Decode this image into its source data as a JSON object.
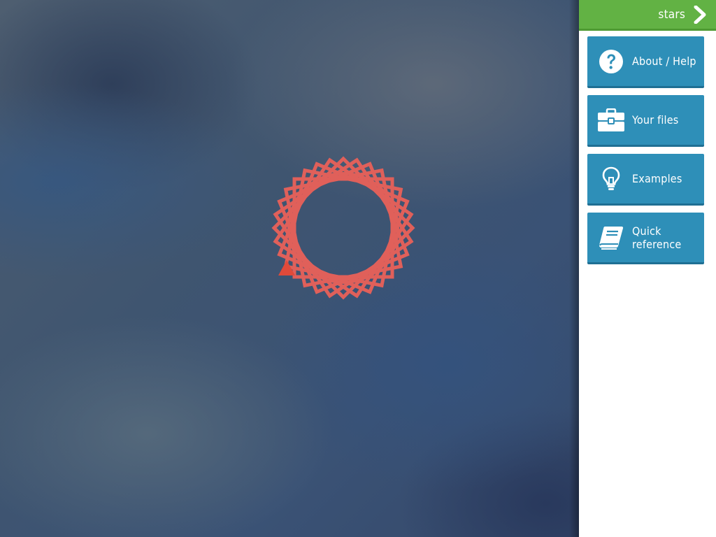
{
  "canvas": {
    "drawing": {
      "color": "#e0605a",
      "turtle_color": "#e04a3a"
    }
  },
  "sidebar": {
    "topbar": {
      "label": "stars",
      "icon": "chevron-right-icon",
      "color": "#62b244"
    },
    "items": [
      {
        "label": "About / Help",
        "icon": "question-circle-icon"
      },
      {
        "label": "Your files",
        "icon": "briefcase-icon"
      },
      {
        "label": "Examples",
        "icon": "lightbulb-icon"
      },
      {
        "label": "Quick reference",
        "icon": "book-icon"
      }
    ],
    "button_color": "#2e8fb8"
  }
}
